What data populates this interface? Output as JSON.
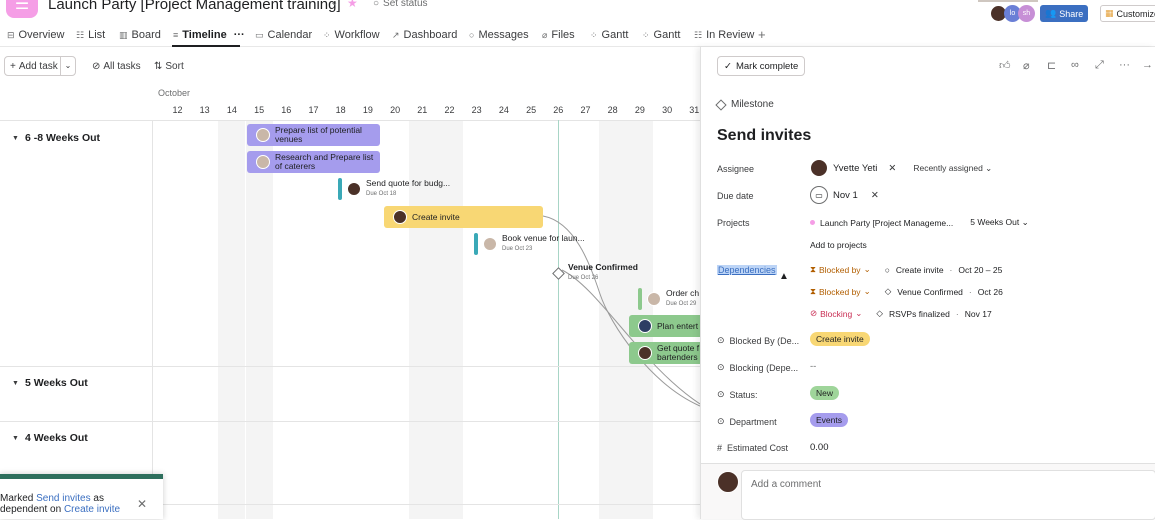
{
  "header": {
    "project_title": "Launch Party [Project Management training]",
    "set_status": "Set status",
    "share_label": "Share",
    "customize_label": "Customize",
    "avatar_initials": [
      "lo",
      "sh"
    ]
  },
  "tabs": [
    {
      "label": "Overview"
    },
    {
      "label": "List"
    },
    {
      "label": "Board"
    },
    {
      "label": "Timeline"
    },
    {
      "label": "Calendar"
    },
    {
      "label": "Workflow"
    },
    {
      "label": "Dashboard"
    },
    {
      "label": "Messages"
    },
    {
      "label": "Files"
    },
    {
      "label": "Gantt"
    },
    {
      "label": "Gantt"
    },
    {
      "label": "In Review"
    }
  ],
  "toolbar": {
    "add_task": "Add task",
    "all_tasks": "All tasks",
    "sort": "Sort"
  },
  "timeline": {
    "month": "October",
    "days": [
      "12",
      "13",
      "14",
      "15",
      "16",
      "17",
      "18",
      "19",
      "20",
      "21",
      "22",
      "23",
      "24",
      "25",
      "26",
      "27",
      "28",
      "29",
      "30",
      "31"
    ],
    "sections": [
      "6 -8 Weeks Out",
      "5 Weeks Out",
      "4 Weeks Out"
    ],
    "tasks": {
      "prepare_venues": "Prepare list of potential venues",
      "research_caterers": "Research and Prepare list of caterers",
      "send_quote": "Send quote for budg...",
      "send_quote_due": "Due Oct 18",
      "create_invite": "Create invite",
      "book_venue": "Book venue for laun...",
      "book_venue_due": "Due Oct 23",
      "venue_confirmed": "Venue Confirmed",
      "venue_confirmed_due": "Due Oct 26",
      "order_ch": "Order ch",
      "order_ch_due": "Due Oct 29",
      "plan_ent": "Plan entert",
      "get_quote": "Get quote f bartenders"
    }
  },
  "toast": {
    "prefix": "Marked",
    "link1": "Send invites",
    "mid": "as",
    "line2_prefix": "dependent on",
    "link2": "Create invite"
  },
  "panel": {
    "mark_complete": "Mark complete",
    "type_label": "Milestone",
    "title": "Send invites",
    "fields": {
      "assignee_label": "Assignee",
      "assignee_name": "Yvette Yeti",
      "recently_assigned": "Recently assigned",
      "due_label": "Due date",
      "due_value": "Nov 1",
      "projects_label": "Projects",
      "project_name": "Launch Party [Project Manageme...",
      "project_section": "5 Weeks Out",
      "add_to_projects": "Add to projects",
      "dependencies_label": "Dependencies",
      "blocked_by_de_label": "Blocked By (De...",
      "blocked_by_de_value": "Create invite",
      "blocking_de_label": "Blocking (Depe...",
      "blocking_de_value": "--",
      "status_label": "Status:",
      "status_value": "New",
      "department_label": "Department",
      "department_value": "Events",
      "cost_label": "Estimated Cost",
      "cost_value": "0.00"
    },
    "dependencies": [
      {
        "kind": "Blocked by",
        "task": "Create invite",
        "date": "Oct 20 – 25"
      },
      {
        "kind": "Blocked by",
        "task": "Venue Confirmed",
        "date": "Oct 26"
      },
      {
        "kind": "Blocking",
        "task": "RSVPs finalized",
        "date": "Nov 17"
      }
    ],
    "comment_placeholder": "Add a comment"
  },
  "colors": {
    "accent_blue": "#3b6fc1",
    "purple_bar": "#a59ced",
    "yellow_bar": "#f8d774",
    "green_bar": "#8dc98d",
    "app_pink": "#f59ee6"
  }
}
